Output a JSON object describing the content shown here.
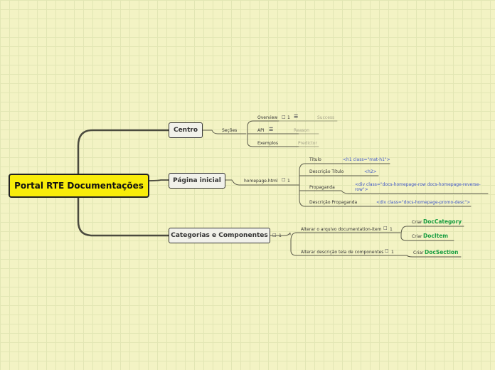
{
  "root": {
    "title": "Portal RTE Documentações"
  },
  "centro": {
    "label": "Centro",
    "secoes_label": "Seções",
    "items": [
      {
        "label": "Overview",
        "count": "1",
        "note": "Success"
      },
      {
        "label": "API",
        "note": "Reason"
      },
      {
        "label": "Exemplos",
        "note": "Predictor"
      }
    ]
  },
  "pagina": {
    "label": "Página inicial",
    "file_label": "homepage.html",
    "count": "1",
    "items": [
      {
        "label": "Título",
        "code": "<h1 class=\"mat-h1\">"
      },
      {
        "label": "Descrição Título",
        "code": "<h2>"
      },
      {
        "label": "Propaganda",
        "code": "<div class=\"docs-homepage-row docs-homepage-reverse-",
        "code2": "row\">"
      },
      {
        "label": "Descrição Propaganda",
        "code": "<div class=\"docs-homepage-promo-desc\">"
      }
    ]
  },
  "categorias": {
    "label": "Categorias e Componentes",
    "count": "1",
    "items": [
      {
        "label": "Alterar o arquivo documentation-item",
        "count": "1",
        "subs": [
          {
            "prefix": "Criar",
            "name": "DocCategory"
          },
          {
            "prefix": "Criar",
            "name": "DocItem"
          }
        ]
      },
      {
        "label": "Alterar descrição tela de componentes",
        "count": "1",
        "subs": [
          {
            "prefix": "Criar",
            "name": "DocSection"
          }
        ]
      }
    ]
  }
}
